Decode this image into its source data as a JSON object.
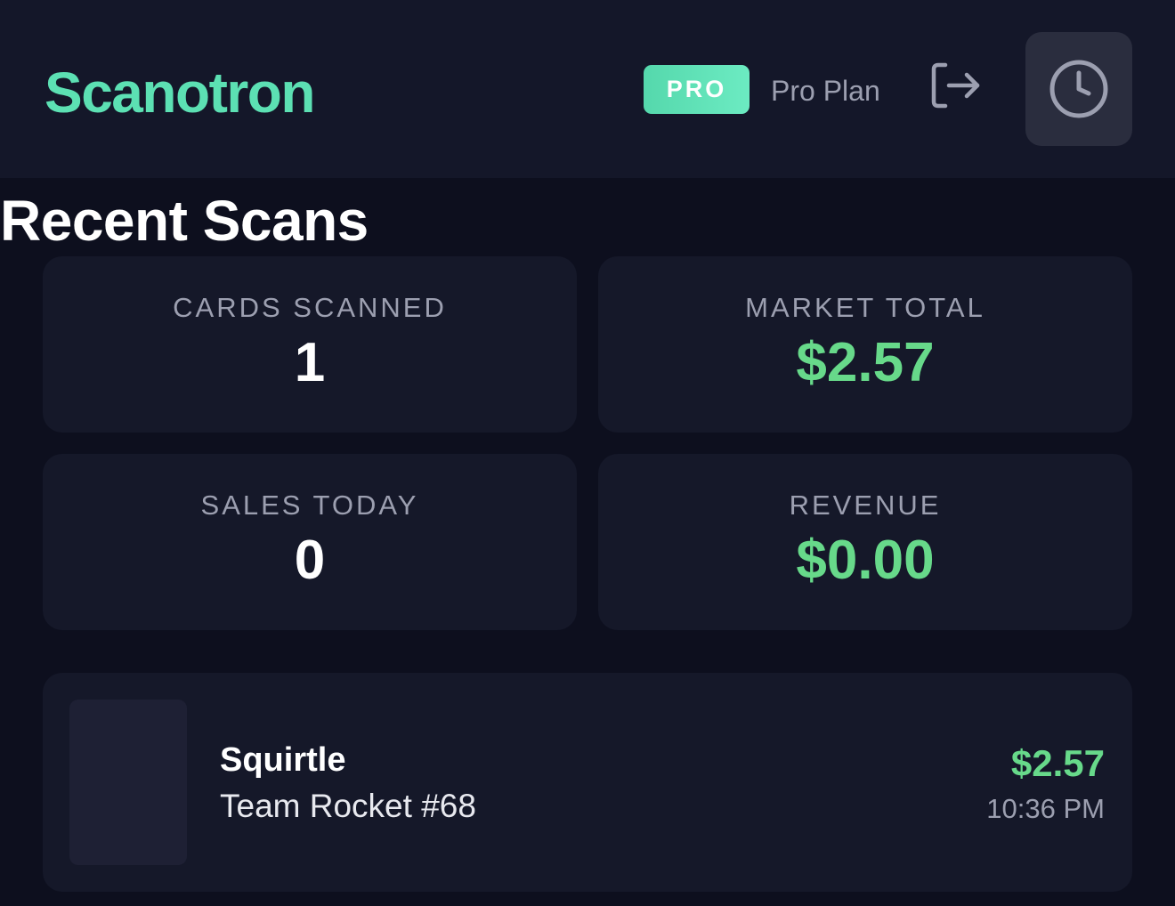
{
  "header": {
    "brand": "Scanotron",
    "badge": "PRO",
    "plan": "Pro Plan",
    "logout_icon": "logout-icon",
    "history_icon": "clock-icon"
  },
  "page": {
    "title": "Recent Scans"
  },
  "stats": [
    {
      "label": "CARDS SCANNED",
      "value": "1"
    },
    {
      "label": "MARKET TOTAL",
      "value": "$2.57"
    },
    {
      "label": "SALES TODAY",
      "value": "0"
    },
    {
      "label": "REVENUE",
      "value": "$0.00"
    }
  ],
  "scans": [
    {
      "name": "Squirtle",
      "set": "Team Rocket #68",
      "price": "$2.57",
      "time": "10:36 PM"
    }
  ],
  "colors": {
    "background": "#0d0f1e",
    "surface": "#151829",
    "brand": "#5ce0b3",
    "money": "#67d98a",
    "muted": "#9c9fb0"
  }
}
